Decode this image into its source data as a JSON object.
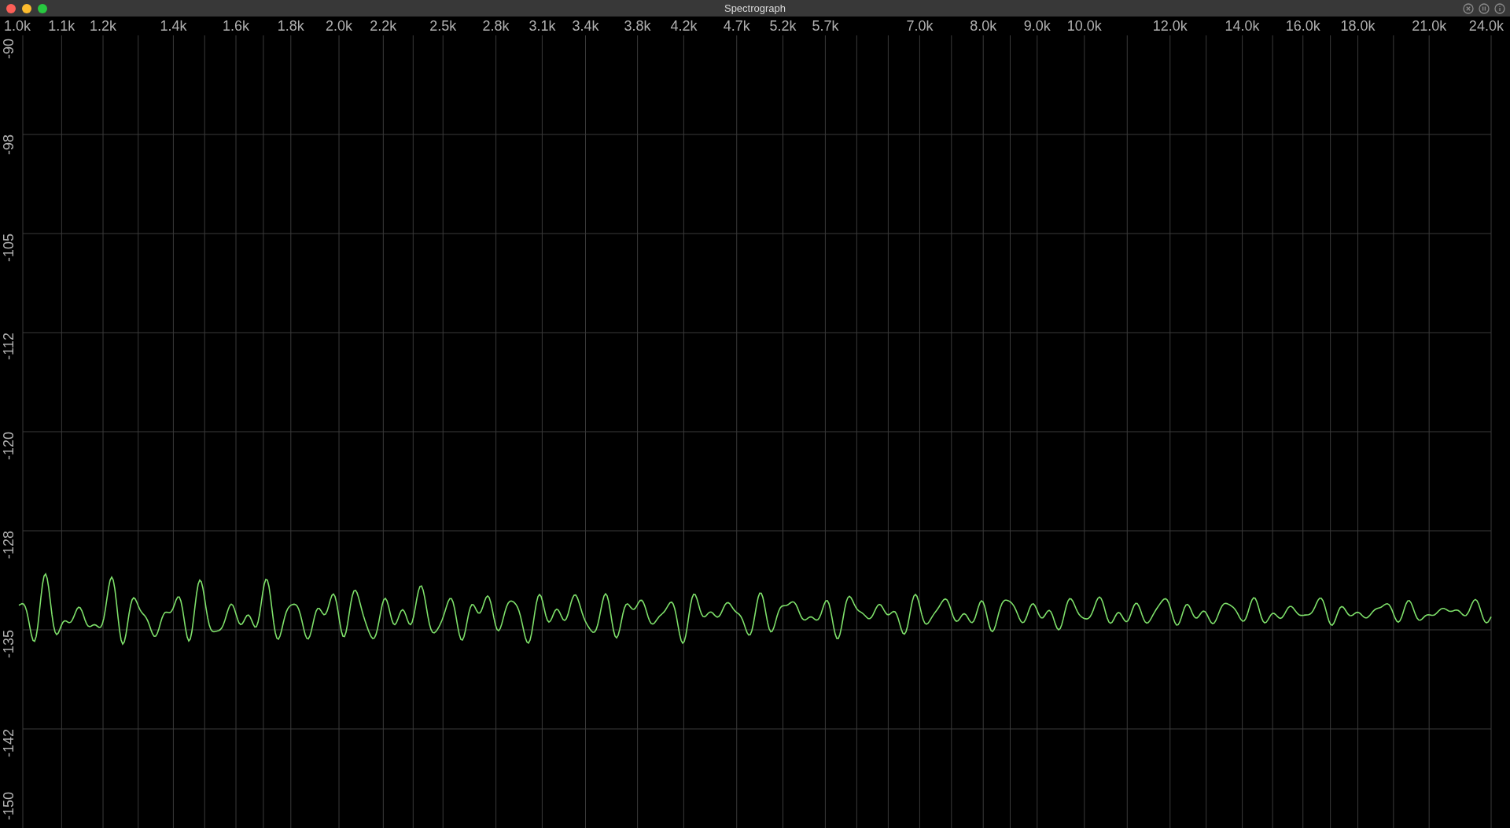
{
  "window": {
    "title": "Spectrograph"
  },
  "frequency_labels": [
    "1.0k",
    "1.1k",
    "1.2k",
    "1.4k",
    "1.6k",
    "1.8k",
    "2.0k",
    "2.2k",
    "2.5k",
    "2.8k",
    "3.1k",
    "3.4k",
    "3.8k",
    "4.2k",
    "4.7k",
    "5.2k",
    "5.7k",
    "7.0k",
    "8.0k",
    "9.0k",
    "10.0k",
    "12.0k",
    "14.0k",
    "16.0k",
    "18.0k",
    "21.0k",
    "24.0k"
  ],
  "level_labels": [
    "-90",
    "-98",
    "-105",
    "-112",
    "-120",
    "-128",
    "-135",
    "-142",
    "-150"
  ]
}
